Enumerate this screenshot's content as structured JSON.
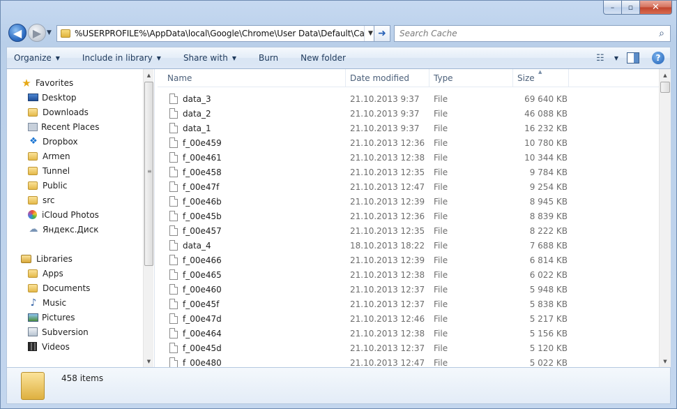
{
  "window": {
    "caption_buttons": {
      "minimize": "–",
      "maximize": "▫",
      "close": "✕"
    }
  },
  "navigation": {
    "back_glyph": "◀",
    "forward_glyph": "▶",
    "recent_glyph": "▼",
    "address": "%USERPROFILE%\\AppData\\local\\Google\\Chrome\\User Data\\Default\\Cache",
    "address_drop_glyph": "▼",
    "go_glyph": "➜",
    "search_placeholder": "Search Cache",
    "search_glyph": "⌕"
  },
  "toolbar": {
    "organize": "Organize",
    "include_in_library": "Include in library",
    "share_with": "Share with",
    "burn": "Burn",
    "new_folder": "New folder",
    "arrow": "▼",
    "views_glyph": "☷",
    "help_glyph": "?"
  },
  "sidebar": {
    "favorites_header": "Favorites",
    "favorites": [
      {
        "label": "Desktop",
        "icon": "desktop-icon"
      },
      {
        "label": "Downloads",
        "icon": "downloads-icon"
      },
      {
        "label": "Recent Places",
        "icon": "recent-places-icon"
      },
      {
        "label": "Dropbox",
        "icon": "dropbox-icon"
      },
      {
        "label": "Armen",
        "icon": "folder-icon"
      },
      {
        "label": "Tunnel",
        "icon": "folder-icon"
      },
      {
        "label": "Public",
        "icon": "folder-icon"
      },
      {
        "label": "src",
        "icon": "folder-icon"
      },
      {
        "label": "iCloud Photos",
        "icon": "icloud-icon"
      },
      {
        "label": "Яндекс.Диск",
        "icon": "yandex-disk-icon"
      }
    ],
    "libraries_header": "Libraries",
    "libraries": [
      {
        "label": "Apps",
        "icon": "folder-icon"
      },
      {
        "label": "Documents",
        "icon": "documents-icon"
      },
      {
        "label": "Music",
        "icon": "music-icon"
      },
      {
        "label": "Pictures",
        "icon": "pictures-icon"
      },
      {
        "label": "Subversion",
        "icon": "subversion-icon"
      },
      {
        "label": "Videos",
        "icon": "videos-icon"
      }
    ],
    "scroll_up": "▲",
    "scroll_down": "▼",
    "grip": "≡"
  },
  "file_list": {
    "columns": {
      "name": "Name",
      "date_modified": "Date modified",
      "type": "Type",
      "size": "Size"
    },
    "sort_glyph": "▲",
    "rows": [
      {
        "name": "data_3",
        "date": "21.10.2013 9:37",
        "type": "File",
        "size": "69 640 KB"
      },
      {
        "name": "data_2",
        "date": "21.10.2013 9:37",
        "type": "File",
        "size": "46 088 KB"
      },
      {
        "name": "data_1",
        "date": "21.10.2013 9:37",
        "type": "File",
        "size": "16 232 KB"
      },
      {
        "name": "f_00e459",
        "date": "21.10.2013 12:36",
        "type": "File",
        "size": "10 780 KB"
      },
      {
        "name": "f_00e461",
        "date": "21.10.2013 12:38",
        "type": "File",
        "size": "10 344 KB"
      },
      {
        "name": "f_00e458",
        "date": "21.10.2013 12:35",
        "type": "File",
        "size": "9 784 KB"
      },
      {
        "name": "f_00e47f",
        "date": "21.10.2013 12:47",
        "type": "File",
        "size": "9 254 KB"
      },
      {
        "name": "f_00e46b",
        "date": "21.10.2013 12:39",
        "type": "File",
        "size": "8 945 KB"
      },
      {
        "name": "f_00e45b",
        "date": "21.10.2013 12:36",
        "type": "File",
        "size": "8 839 KB"
      },
      {
        "name": "f_00e457",
        "date": "21.10.2013 12:35",
        "type": "File",
        "size": "8 222 KB"
      },
      {
        "name": "data_4",
        "date": "18.10.2013 18:22",
        "type": "File",
        "size": "7 688 KB"
      },
      {
        "name": "f_00e466",
        "date": "21.10.2013 12:39",
        "type": "File",
        "size": "6 814 KB"
      },
      {
        "name": "f_00e465",
        "date": "21.10.2013 12:38",
        "type": "File",
        "size": "6 022 KB"
      },
      {
        "name": "f_00e460",
        "date": "21.10.2013 12:37",
        "type": "File",
        "size": "5 948 KB"
      },
      {
        "name": "f_00e45f",
        "date": "21.10.2013 12:37",
        "type": "File",
        "size": "5 838 KB"
      },
      {
        "name": "f_00e47d",
        "date": "21.10.2013 12:46",
        "type": "File",
        "size": "5 217 KB"
      },
      {
        "name": "f_00e464",
        "date": "21.10.2013 12:38",
        "type": "File",
        "size": "5 156 KB"
      },
      {
        "name": "f_00e45d",
        "date": "21.10.2013 12:37",
        "type": "File",
        "size": "5 120 KB"
      },
      {
        "name": "f_00e480",
        "date": "21.10.2013 12:47",
        "type": "File",
        "size": "5 022 KB"
      }
    ]
  },
  "details": {
    "item_count": "458 items"
  },
  "colors": {
    "frame": "#b9cfe9",
    "close_button": "#c0452d",
    "accent": "#2f6fc4"
  }
}
